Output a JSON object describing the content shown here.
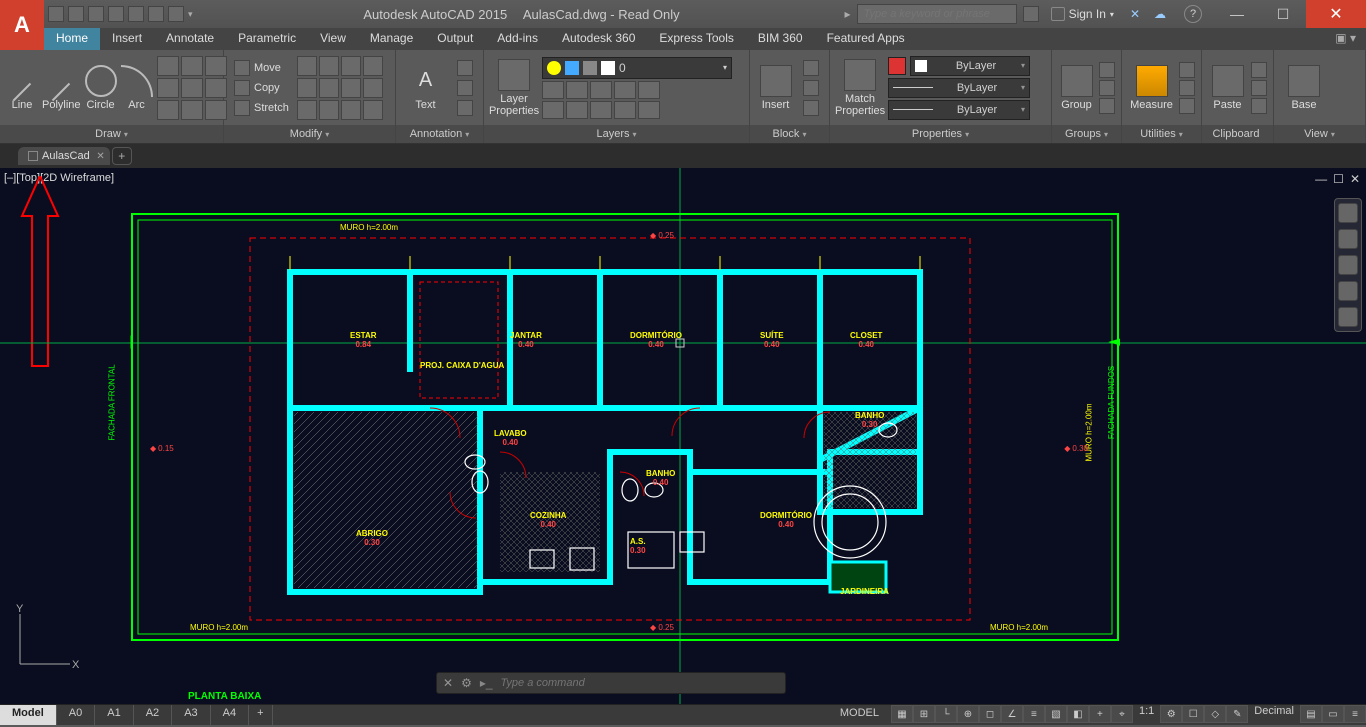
{
  "title": {
    "app": "Autodesk AutoCAD 2015",
    "file": "AulasCad.dwg - Read Only"
  },
  "search_placeholder": "Type a keyword or phrase",
  "signin": "Sign In",
  "tabs": [
    "Home",
    "Insert",
    "Annotate",
    "Parametric",
    "View",
    "Manage",
    "Output",
    "Add-ins",
    "Autodesk 360",
    "Express Tools",
    "BIM 360",
    "Featured Apps"
  ],
  "panels": {
    "draw": {
      "title": "Draw",
      "btns": [
        "Line",
        "Polyline",
        "Circle",
        "Arc"
      ]
    },
    "modify": {
      "title": "Modify",
      "items": [
        "Move",
        "Copy",
        "Stretch"
      ]
    },
    "annotation": {
      "title": "Annotation",
      "btn": "Text"
    },
    "layers": {
      "title": "Layers",
      "btn": "Layer\nProperties",
      "current": "0"
    },
    "block": {
      "title": "Block",
      "btn": "Insert"
    },
    "properties": {
      "title": "Properties",
      "btn": "Match\nProperties",
      "bylayer": "ByLayer"
    },
    "groups": {
      "title": "Groups",
      "btn": "Group"
    },
    "utilities": {
      "title": "Utilities",
      "btn": "Measure"
    },
    "clipboard": {
      "title": "Clipboard",
      "btn": "Paste"
    },
    "view": {
      "title": "View",
      "btn": "Base"
    }
  },
  "file_tab": "AulasCad",
  "viewport_label": "[–][Top][2D Wireframe]",
  "cmd_placeholder": "Type a command",
  "layout_tabs": [
    "Model",
    "A0",
    "A1",
    "A2",
    "A3",
    "A4"
  ],
  "status": {
    "model": "MODEL",
    "scale": "1:1",
    "units": "Decimal"
  },
  "planta": "PLANTA BAIXA",
  "fachada_l": "FACHADA FRONTAL",
  "fachada_r": "FACHADA FUNDOS",
  "muro_top": "MURO  h=2.00m",
  "muro_bot": "MURO  h=2.00m",
  "muro_r": "MURO  h=2.00m",
  "dim_top": "0.25",
  "dim_bot": "0.25",
  "dim_left": "0.15",
  "dim_right": "0.30",
  "rooms": {
    "estar": {
      "n": "ESTAR",
      "d": "0.84"
    },
    "jantar": {
      "n": "JANTAR",
      "d": "0.40"
    },
    "dorm1": {
      "n": "DORMITÓRIO",
      "d": "0.40"
    },
    "suite": {
      "n": "SUÍTE",
      "d": "0.40"
    },
    "closet": {
      "n": "CLOSET",
      "d": "0.40"
    },
    "banho1": {
      "n": "BANHO",
      "d": "0.30"
    },
    "lavabo": {
      "n": "LAVABO",
      "d": "0.40"
    },
    "cozinha": {
      "n": "COZINHA",
      "d": "0.40"
    },
    "banho2": {
      "n": "BANHO",
      "d": "0.40"
    },
    "as": {
      "n": "A.S.",
      "d": "0.30"
    },
    "dorm2": {
      "n": "DORMITÓRIO",
      "d": "0.40"
    },
    "abrigo": {
      "n": "ABRIGO",
      "d": "0.30"
    },
    "jard": {
      "n": "JARDINEIRA",
      "d": ""
    },
    "proj": {
      "n": "PROJ. CAIXA D'AGUA",
      "d": ""
    }
  }
}
